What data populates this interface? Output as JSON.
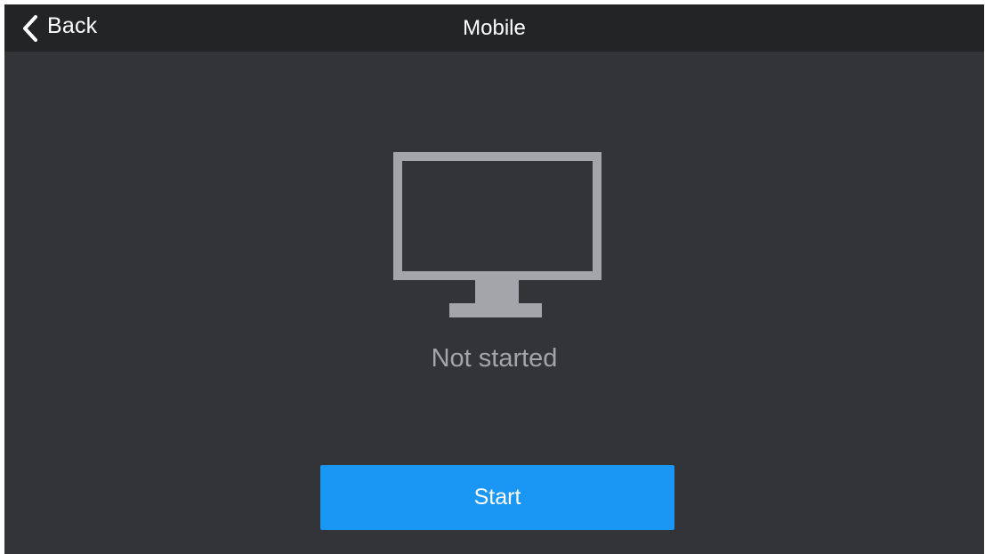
{
  "header": {
    "back_label": "Back",
    "title": "Mobile",
    "back_icon": "chevron-left-icon"
  },
  "main": {
    "icon": "monitor-icon",
    "status": "Not started",
    "start_label": "Start"
  },
  "colors": {
    "background": "#333438",
    "header_background": "#232426",
    "icon": "#a3a5aa",
    "status_text": "#a3a5aa",
    "accent": "#1a96f5",
    "text": "#ffffff"
  }
}
